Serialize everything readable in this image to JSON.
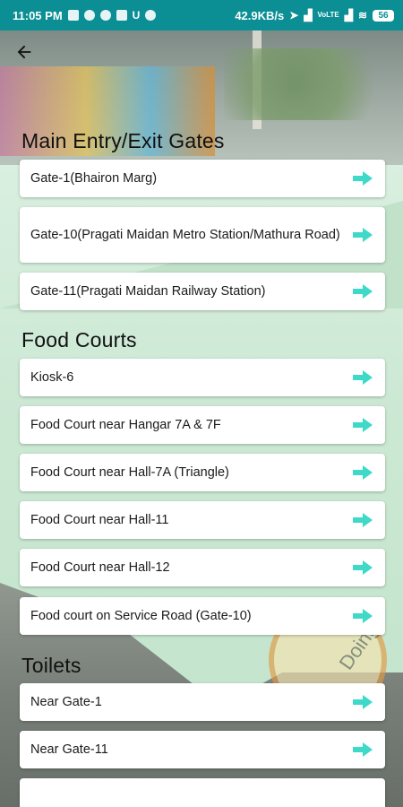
{
  "status_bar": {
    "time": "11:05 PM",
    "net_speed": "42.9KB/s",
    "volte": "VoLTE",
    "battery": "56"
  },
  "colors": {
    "status_bar": "#0b8f94",
    "arrow": "#3fd9c9",
    "card": "#ffffff"
  },
  "icons": {
    "back": "arrow-left-icon",
    "row_arrow": "arrow-right-icon"
  },
  "sections": {
    "gates": {
      "title": "Main Entry/Exit Gates",
      "items": [
        "Gate-1(Bhairon Marg)",
        "Gate-10(Pragati Maidan Metro Station/Mathura Road)",
        "Gate-11(Pragati Maidan Railway Station)"
      ]
    },
    "food": {
      "title": "Food Courts",
      "items": [
        "Kiosk-6",
        "Food Court near Hangar 7A & 7F",
        "Food Court near Hall-7A (Triangle)",
        "Food Court near Hall-11",
        "Food Court near Hall-12",
        "Food court on Service Road (Gate-10)"
      ]
    },
    "toilets": {
      "title": "Toilets",
      "items": [
        "Near Gate-1",
        "Near Gate-11",
        ""
      ]
    }
  }
}
